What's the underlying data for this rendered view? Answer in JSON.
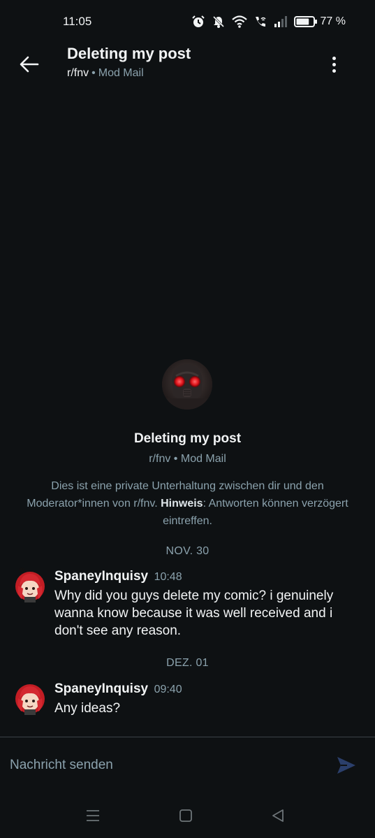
{
  "status_bar": {
    "time": "11:05",
    "battery_percent": "77 %",
    "battery_level": 0.77,
    "icons": [
      "alarm-icon",
      "mute-icon",
      "wifi-icon",
      "wifi-calling-icon",
      "signal-icon",
      "battery-icon"
    ]
  },
  "header": {
    "title": "Deleting my post",
    "subreddit": "r/fnv",
    "separator": "•",
    "type": "Mod Mail"
  },
  "intro": {
    "title": "Deleting my post",
    "subreddit": "r/fnv",
    "separator": "•",
    "type": "Mod Mail",
    "desc_part1": "Dies ist eine private Unterhaltung zwischen dir und den Moderator*innen von r/fnv. ",
    "desc_bold": "Hinweis",
    "desc_part2": ": Antworten können verzögert eintreffen."
  },
  "dates": [
    "NOV. 30",
    "DEZ. 01"
  ],
  "messages": [
    {
      "author": "SpaneyInquisy",
      "time": "10:48",
      "text": "Why did you guys delete my comic? i genuinely wanna know because it was well received and i don't see any reason."
    },
    {
      "author": "SpaneyInquisy",
      "time": "09:40",
      "text": "Any ideas?"
    }
  ],
  "composer": {
    "placeholder": "Nachricht senden"
  },
  "colors": {
    "background": "#0e1113",
    "text": "#f2f4f5",
    "muted": "#8ba2ad",
    "send_button": "#2b3f6b"
  },
  "nav_bar": {
    "icons": [
      "menu-icon",
      "home-square-icon",
      "back-triangle-icon"
    ]
  }
}
